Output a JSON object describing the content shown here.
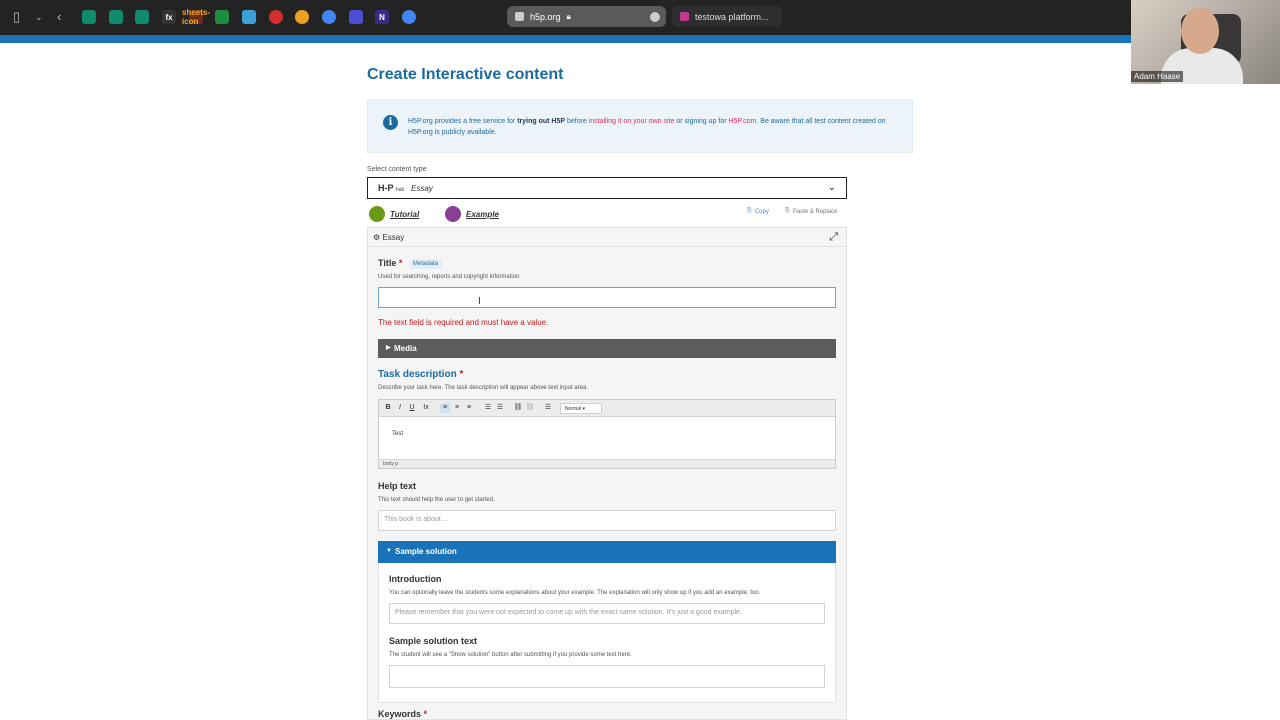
{
  "browser": {
    "tabs": [
      {
        "label": "h5p.org",
        "active": true
      },
      {
        "label": "testowa platform...",
        "active": false
      }
    ],
    "bookmarks": [
      "sidebar-icon",
      "chevron-down-icon",
      "back-icon",
      "app-icon",
      "app-icon",
      "app-icon",
      "inv",
      "fx",
      "sheets-icon",
      "app-icon",
      "record-icon",
      "app-icon",
      "chrome-icon",
      "app-icon",
      "N",
      "chrome-icon"
    ]
  },
  "webcam": {
    "name": "Adam Haase"
  },
  "page": {
    "title": "Create Interactive content",
    "notice": {
      "part1": "H5P.org provides a free service for ",
      "bold": "trying out H5P",
      "part2": " before ",
      "link1": "installing it on your own site",
      "part3": " or signing up for ",
      "link2": "H5P.com",
      "part4": ". Be aware that all test content created on H5P.org is publicly available."
    },
    "select_label": "Select content type",
    "select_logo": "H-P",
    "select_logo_small": "hub",
    "select_value": "Essay",
    "tutorial": "Tutorial",
    "example": "Example",
    "copy": "Copy",
    "paste": "Paste & Replace"
  },
  "form": {
    "header": "Essay",
    "title_label": "Title",
    "metadata": "Metadata",
    "title_desc": "Used for searching, reports and copyright information",
    "title_value": "",
    "title_error": "The text field is required and must have a value.",
    "media": "Media",
    "task_label": "Task description",
    "task_desc": "Describe your task here. The task description will appear above text input area.",
    "format": "Normal",
    "task_content": "Test",
    "editor_path": "body  p",
    "help_label": "Help text",
    "help_desc": "This text should help the user to get started.",
    "help_placeholder": "This book is about ...",
    "sample_solution": "Sample solution",
    "intro_label": "Introduction",
    "intro_desc": "You can optionally leave the students some explanations about your example. The explanation will only show up if you add an example, too.",
    "intro_placeholder": "Please remember that you were not expected to come up with the exact same solution. It's just a good example.",
    "sample_text_label": "Sample solution text",
    "sample_text_desc": "The student will see a \"Show solution\" button after submitting if you provide some text here.",
    "keywords_label": "Keywords"
  },
  "colors": {
    "accent": "#1a73b9",
    "title_blue": "#1c6ba0",
    "error": "#c41b1b",
    "tutorial": "#6b9a18",
    "example": "#8a3f96"
  }
}
